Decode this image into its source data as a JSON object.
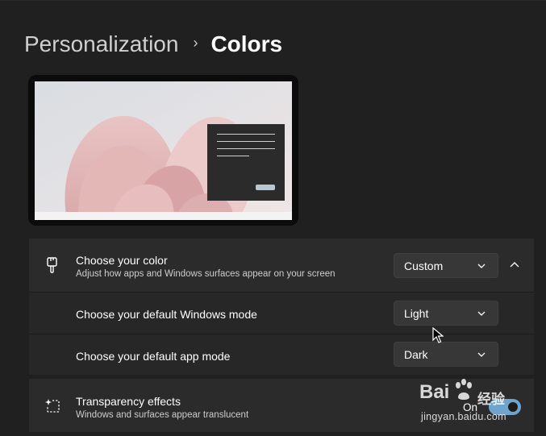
{
  "breadcrumb": {
    "parent": "Personalization",
    "separator": "›",
    "current": "Colors"
  },
  "color_section": {
    "title": "Choose your color",
    "description": "Adjust how apps and Windows surfaces appear on your screen",
    "selected": "Custom",
    "icon": "paintbrush-icon",
    "expand_icon": "chevron-up-icon"
  },
  "windows_mode": {
    "title": "Choose your default Windows mode",
    "selected": "Light"
  },
  "app_mode": {
    "title": "Choose your default app mode",
    "selected": "Dark"
  },
  "transparency": {
    "title": "Transparency effects",
    "description": "Windows and surfaces appear translucent",
    "state_label": "On",
    "is_on": true,
    "icon": "sparkle-icon"
  },
  "watermark": {
    "logo_text": "Bai",
    "logo_suffix": "经验",
    "url": "jingyan.baidu.com"
  },
  "colors": {
    "background": "#202020",
    "card": "#2b2b2b",
    "accent": "#6fa4cc",
    "dropdown": "#373737"
  }
}
